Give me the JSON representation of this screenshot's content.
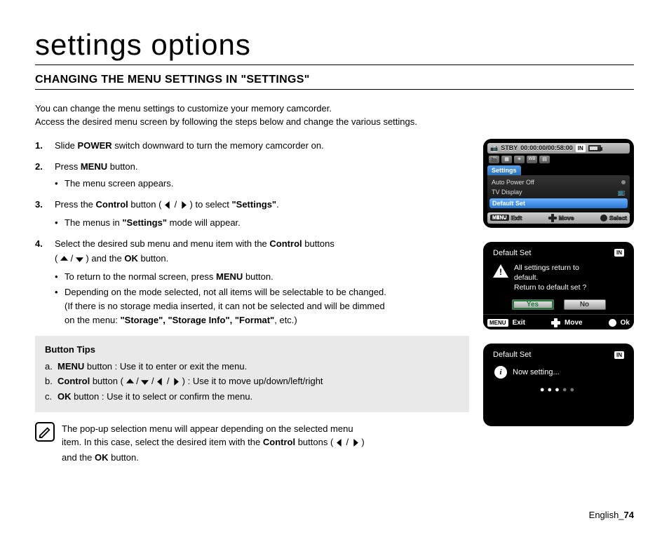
{
  "page": {
    "title": "settings options",
    "section": "CHANGING THE MENU SETTINGS IN \"SETTINGS\"",
    "intro1": "You can change the menu settings to customize your memory camcorder.",
    "intro2": "Access the desired menu screen by following the steps below and change the various settings."
  },
  "steps": {
    "s1a": "Slide ",
    "s1b": "POWER",
    "s1c": " switch downward to turn the memory camcorder on.",
    "s2a": "Press ",
    "s2b": "MENU",
    "s2c": " button.",
    "s2_1": "The menu screen appears.",
    "s3a": "Press the ",
    "s3b": "Control",
    "s3c": " button ( ",
    "s3d": " / ",
    "s3e": " ) to select ",
    "s3f": "\"Settings\"",
    "s3g": ".",
    "s3_1a": "The menus in ",
    "s3_1b": "\"Settings\"",
    "s3_1c": " mode will appear.",
    "s4a": "Select the desired sub menu and menu item with the ",
    "s4b": "Control",
    "s4c": " buttons",
    "s4d": "( ",
    "s4e": " / ",
    "s4f": " ) and the ",
    "s4g": "OK",
    "s4h": " button.",
    "s4_1a": "To return to the normal screen, press ",
    "s4_1b": "MENU",
    "s4_1c": " button.",
    "s4_2a": "Depending on the mode selected, not all items will be selectable to be changed.",
    "s4_2b": "(If there is no storage media inserted, it can not be selected and will be dimmed",
    "s4_2c": "on the menu: ",
    "s4_2d": "\"Storage\", \"Storage Info\", \"Format\"",
    "s4_2e": ", etc.)"
  },
  "tips": {
    "title": "Button Tips",
    "a1": "a.",
    "a2": "MENU",
    "a3": " button : Use it to enter or exit the menu.",
    "b1": "b.",
    "b2": "Control",
    "b3": " button ( ",
    "b4": " / ",
    "b5": " / ",
    "b6": " / ",
    "b7": " ) : Use it to move up/down/left/right",
    "c1": "c.",
    "c2": "OK",
    "c3": " button : Use it to select or confirm the menu."
  },
  "note": {
    "t1": "The pop-up selection menu will appear depending on the selected menu",
    "t2": "item. In this case, select the desired item with the ",
    "t3": "Control",
    "t4": " buttons ( ",
    "t5": " / ",
    "t6": " )",
    "t7": "and the ",
    "t8": "OK",
    "t9": " button."
  },
  "lcd1": {
    "status": "STBY",
    "time": "00:00:00/00:58:00",
    "in": "IN",
    "tab": "Settings",
    "rows": [
      "Auto Power Off",
      "TV Display"
    ],
    "selected": "Default Set",
    "bottom": {
      "menu": "MENU",
      "exit": "Exit",
      "move": "Move",
      "select": "Select"
    }
  },
  "lcd2": {
    "title": "Default Set",
    "in": "IN",
    "msg1": "All settings return to",
    "msg2": "default.",
    "msg3": "Return to default set ?",
    "yes": "Yes",
    "no": "No",
    "bottom": {
      "menu": "MENU",
      "exit": "Exit",
      "move": "Move",
      "ok": "Ok"
    }
  },
  "lcd3": {
    "title": "Default Set",
    "in": "IN",
    "msg": "Now setting..."
  },
  "footer": {
    "lang": "English",
    "sep": "_",
    "page": "74"
  }
}
